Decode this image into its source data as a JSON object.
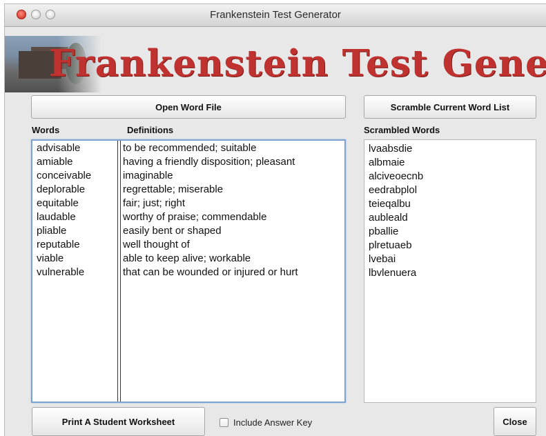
{
  "window": {
    "title": "Frankenstein Test Generator"
  },
  "banner": {
    "title": "Frankenstein Test Generator"
  },
  "buttons": {
    "open_word_file": "Open Word File",
    "scramble": "Scramble Current Word List",
    "print_worksheet": "Print A Student Worksheet",
    "close": "Close"
  },
  "checkbox": {
    "include_answer_key": "Include Answer Key",
    "checked": false
  },
  "headers": {
    "words": "Words",
    "definitions": "Definitions",
    "scrambled": "Scrambled Words"
  },
  "words": [
    "advisable",
    "amiable",
    "conceivable",
    "deplorable",
    "equitable",
    "laudable",
    "pliable",
    "reputable",
    "viable",
    "vulnerable"
  ],
  "definitions": [
    "to be recommended; suitable",
    "having a friendly disposition; pleasant",
    "imaginable",
    "regrettable; miserable",
    "fair; just; right",
    "worthy of praise; commendable",
    "easily bent or shaped",
    "well thought of",
    "able to keep alive; workable",
    "that can be wounded or injured or hurt"
  ],
  "scrambled": [
    "lvaabsdie",
    "albmaie",
    "alciveoecnb",
    "eedrabplol",
    "teieqalbu",
    "aubleald",
    "pballie",
    "plretuaeb",
    "lvebai",
    "lbvlenuera"
  ],
  "colors": {
    "banner_red": "#c0322f",
    "focus_ring": "#7da3d2"
  }
}
